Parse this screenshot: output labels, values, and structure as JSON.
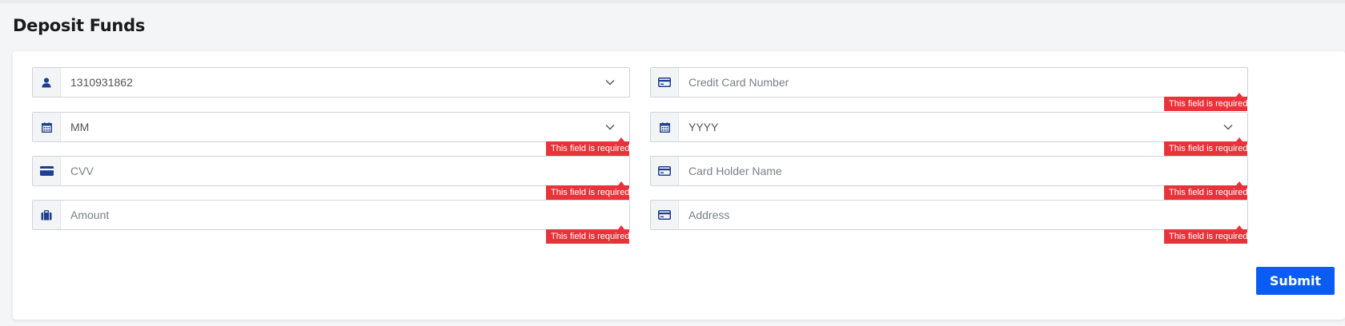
{
  "page_title": "Deposit Funds",
  "form": {
    "account_select": {
      "value": "1310931862",
      "icon": "user-icon"
    },
    "card_number": {
      "placeholder": "Credit Card Number",
      "value": "",
      "icon": "credit-card-icon",
      "error": "This field is required."
    },
    "expiry_month": {
      "value": "MM",
      "icon": "calendar-icon",
      "error": "This field is required."
    },
    "expiry_year": {
      "value": "YYYY",
      "icon": "calendar-icon",
      "error": "This field is required."
    },
    "cvv": {
      "placeholder": "CVV",
      "value": "",
      "icon": "credit-card-icon",
      "error": "This field is required."
    },
    "card_holder": {
      "placeholder": "Card Holder Name",
      "value": "",
      "icon": "credit-card-icon",
      "error": "This field is required."
    },
    "amount": {
      "placeholder": "Amount",
      "value": "",
      "icon": "briefcase-icon",
      "error": "This field is required."
    },
    "address": {
      "placeholder": "Address",
      "value": "",
      "icon": "credit-card-icon",
      "error": "This field is required."
    },
    "submit_label": "Submit"
  },
  "colors": {
    "accent": "#0a5cf5",
    "icon": "#1c3f8f",
    "error": "#e8333b"
  }
}
